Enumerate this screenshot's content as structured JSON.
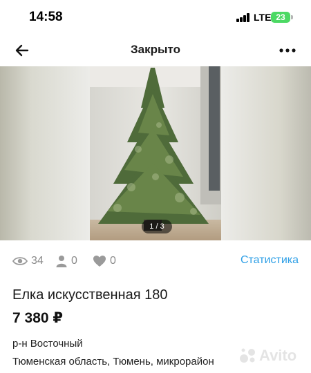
{
  "status_bar": {
    "time": "14:58",
    "network": "LTE",
    "battery": "23"
  },
  "nav": {
    "title": "Закрыто",
    "back_icon": "arrow-left-icon",
    "more_icon": "more-dots-icon"
  },
  "gallery": {
    "counter": "1 / 3"
  },
  "stats": {
    "views": "34",
    "contacts": "0",
    "favorites": "0",
    "link_label": "Статистика",
    "link_color": "#2e9fe6"
  },
  "listing": {
    "title": "Елка искусственная 180",
    "price": "7 380 ₽",
    "district": "р-н Восточный",
    "address": "Тюменская область, Тюмень, микрорайон"
  },
  "watermark": {
    "text": "Avito"
  }
}
